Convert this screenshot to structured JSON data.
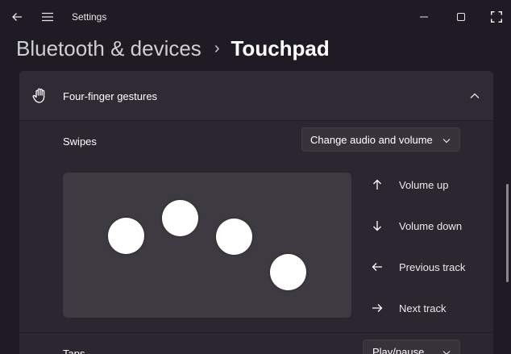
{
  "window": {
    "app_title": "Settings"
  },
  "breadcrumb": {
    "parent": "Bluetooth & devices",
    "separator": "›",
    "current": "Touchpad"
  },
  "section": {
    "title": "Four-finger gestures",
    "expanded": true,
    "icon": "hand-icon"
  },
  "swipes": {
    "label": "Swipes",
    "selected": "Change audio and volume"
  },
  "actions": [
    {
      "icon": "arrow-up-icon",
      "label": "Volume up"
    },
    {
      "icon": "arrow-down-icon",
      "label": "Volume down"
    },
    {
      "icon": "arrow-left-icon",
      "label": "Previous track"
    },
    {
      "icon": "arrow-right-icon",
      "label": "Next track"
    }
  ],
  "taps": {
    "label": "Taps",
    "selected": "Play/pause"
  },
  "colors": {
    "background": "#1f1b24",
    "panel": "#2b2730",
    "touchpad": "#3e3a41",
    "finger": "#ffffff"
  }
}
